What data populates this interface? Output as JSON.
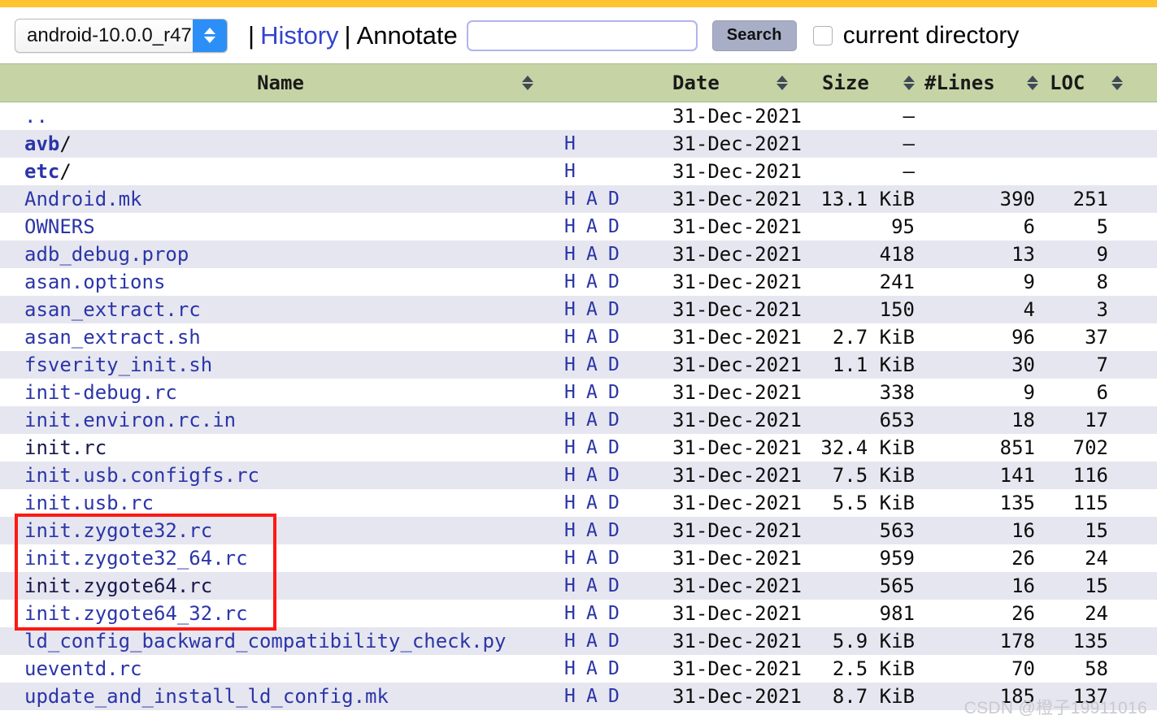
{
  "theme": {
    "accent_bar": "#FFC431",
    "header_bg": "#c6d4a5",
    "row_alt_bg": "#e6e6f0",
    "link": "#2b35a8",
    "visited_link": "#16184a",
    "annotation_box": "#fc1a14",
    "search_button_bg": "#a7aec6",
    "select_stepper_bg": "#2C8FF7"
  },
  "toolbar": {
    "project_select": {
      "selected": "android-10.0.0_r47",
      "options": [
        "android-10.0.0_r47"
      ]
    },
    "separator": "|",
    "history_link": "History",
    "annotate_link": "Annotate",
    "search_value": "",
    "search_placeholder": "",
    "search_button": "Search",
    "current_directory_label": "current directory",
    "current_directory_checked": false
  },
  "table": {
    "columns": [
      {
        "key": "name",
        "label": "Name",
        "sortable": true
      },
      {
        "key": "links",
        "label": "",
        "sortable": false
      },
      {
        "key": "date",
        "label": "Date",
        "sortable": true
      },
      {
        "key": "size",
        "label": "Size",
        "sortable": true
      },
      {
        "key": "lines",
        "label": "#Lines",
        "sortable": true
      },
      {
        "key": "loc",
        "label": "LOC",
        "sortable": true
      }
    ],
    "link_labels": {
      "history": "H",
      "annotate": "A",
      "download": "D"
    },
    "rows": [
      {
        "name": "..",
        "kind": "parent",
        "visited": false,
        "links": [],
        "date": "31-Dec-2021",
        "size": "–",
        "lines": "",
        "loc": ""
      },
      {
        "name": "avb",
        "kind": "directory",
        "visited": false,
        "links": [
          "H"
        ],
        "date": "31-Dec-2021",
        "size": "–",
        "lines": "",
        "loc": ""
      },
      {
        "name": "etc",
        "kind": "directory",
        "visited": false,
        "links": [
          "H"
        ],
        "date": "31-Dec-2021",
        "size": "–",
        "lines": "",
        "loc": ""
      },
      {
        "name": "Android.mk",
        "kind": "file",
        "visited": false,
        "links": [
          "H",
          "A",
          "D"
        ],
        "date": "31-Dec-2021",
        "size": "13.1 KiB",
        "lines": "390",
        "loc": "251"
      },
      {
        "name": "OWNERS",
        "kind": "file",
        "visited": false,
        "links": [
          "H",
          "A",
          "D"
        ],
        "date": "31-Dec-2021",
        "size": "95",
        "lines": "6",
        "loc": "5"
      },
      {
        "name": "adb_debug.prop",
        "kind": "file",
        "visited": false,
        "links": [
          "H",
          "A",
          "D"
        ],
        "date": "31-Dec-2021",
        "size": "418",
        "lines": "13",
        "loc": "9"
      },
      {
        "name": "asan.options",
        "kind": "file",
        "visited": false,
        "links": [
          "H",
          "A",
          "D"
        ],
        "date": "31-Dec-2021",
        "size": "241",
        "lines": "9",
        "loc": "8"
      },
      {
        "name": "asan_extract.rc",
        "kind": "file",
        "visited": false,
        "links": [
          "H",
          "A",
          "D"
        ],
        "date": "31-Dec-2021",
        "size": "150",
        "lines": "4",
        "loc": "3"
      },
      {
        "name": "asan_extract.sh",
        "kind": "file",
        "visited": false,
        "links": [
          "H",
          "A",
          "D"
        ],
        "date": "31-Dec-2021",
        "size": "2.7 KiB",
        "lines": "96",
        "loc": "37"
      },
      {
        "name": "fsverity_init.sh",
        "kind": "file",
        "visited": false,
        "links": [
          "H",
          "A",
          "D"
        ],
        "date": "31-Dec-2021",
        "size": "1.1 KiB",
        "lines": "30",
        "loc": "7"
      },
      {
        "name": "init-debug.rc",
        "kind": "file",
        "visited": false,
        "links": [
          "H",
          "A",
          "D"
        ],
        "date": "31-Dec-2021",
        "size": "338",
        "lines": "9",
        "loc": "6"
      },
      {
        "name": "init.environ.rc.in",
        "kind": "file",
        "visited": false,
        "links": [
          "H",
          "A",
          "D"
        ],
        "date": "31-Dec-2021",
        "size": "653",
        "lines": "18",
        "loc": "17"
      },
      {
        "name": "init.rc",
        "kind": "file",
        "visited": true,
        "links": [
          "H",
          "A",
          "D"
        ],
        "date": "31-Dec-2021",
        "size": "32.4 KiB",
        "lines": "851",
        "loc": "702"
      },
      {
        "name": "init.usb.configfs.rc",
        "kind": "file",
        "visited": false,
        "links": [
          "H",
          "A",
          "D"
        ],
        "date": "31-Dec-2021",
        "size": "7.5 KiB",
        "lines": "141",
        "loc": "116"
      },
      {
        "name": "init.usb.rc",
        "kind": "file",
        "visited": false,
        "links": [
          "H",
          "A",
          "D"
        ],
        "date": "31-Dec-2021",
        "size": "5.5 KiB",
        "lines": "135",
        "loc": "115"
      },
      {
        "name": "init.zygote32.rc",
        "kind": "file",
        "visited": false,
        "links": [
          "H",
          "A",
          "D"
        ],
        "date": "31-Dec-2021",
        "size": "563",
        "lines": "16",
        "loc": "15"
      },
      {
        "name": "init.zygote32_64.rc",
        "kind": "file",
        "visited": false,
        "links": [
          "H",
          "A",
          "D"
        ],
        "date": "31-Dec-2021",
        "size": "959",
        "lines": "26",
        "loc": "24"
      },
      {
        "name": "init.zygote64.rc",
        "kind": "file",
        "visited": true,
        "links": [
          "H",
          "A",
          "D"
        ],
        "date": "31-Dec-2021",
        "size": "565",
        "lines": "16",
        "loc": "15"
      },
      {
        "name": "init.zygote64_32.rc",
        "kind": "file",
        "visited": false,
        "links": [
          "H",
          "A",
          "D"
        ],
        "date": "31-Dec-2021",
        "size": "981",
        "lines": "26",
        "loc": "24"
      },
      {
        "name": "ld_config_backward_compatibility_check.py",
        "kind": "file",
        "visited": false,
        "links": [
          "H",
          "A",
          "D"
        ],
        "date": "31-Dec-2021",
        "size": "5.9 KiB",
        "lines": "178",
        "loc": "135"
      },
      {
        "name": "ueventd.rc",
        "kind": "file",
        "visited": false,
        "links": [
          "H",
          "A",
          "D"
        ],
        "date": "31-Dec-2021",
        "size": "2.5 KiB",
        "lines": "70",
        "loc": "58"
      },
      {
        "name": "update_and_install_ld_config.mk",
        "kind": "file",
        "visited": false,
        "links": [
          "H",
          "A",
          "D"
        ],
        "date": "31-Dec-2021",
        "size": "8.7 KiB",
        "lines": "185",
        "loc": "137"
      }
    ]
  },
  "annotation": {
    "highlight_rows": [
      "init.zygote32.rc",
      "init.zygote32_64.rc",
      "init.zygote64.rc",
      "init.zygote64_32.rc"
    ]
  },
  "watermark": {
    "text": "CSDN @橙子19911016"
  }
}
